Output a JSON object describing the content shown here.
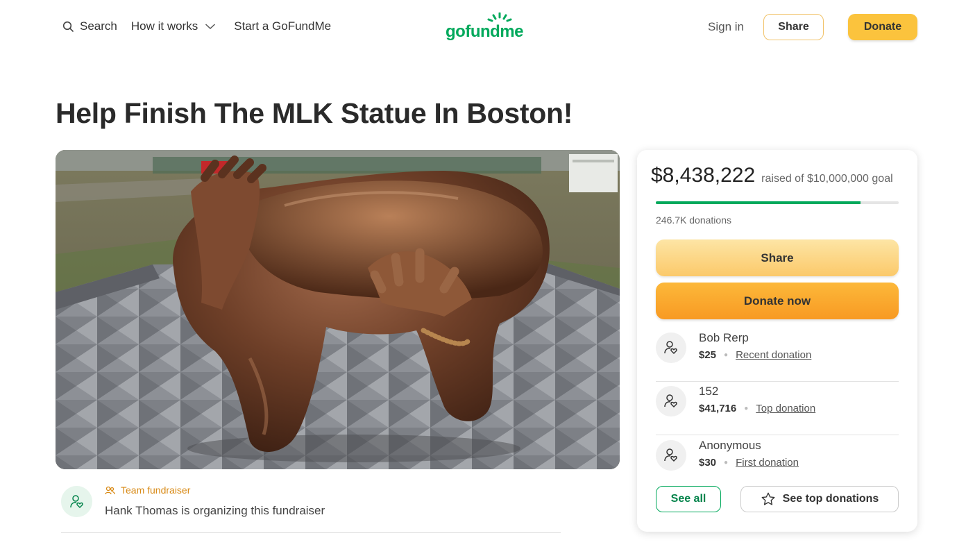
{
  "header": {
    "search_label": "Search",
    "how_it_works_label": "How it works",
    "start_label": "Start a GoFundMe",
    "logo_text": "gofundme",
    "signin_label": "Sign in",
    "share_label": "Share",
    "donate_label": "Donate"
  },
  "campaign": {
    "title": "Help Finish The MLK Statue In Boston!",
    "hero_image": "bronze embrace sculpture on patterned stone plaza"
  },
  "organizer": {
    "tag": "Team fundraiser",
    "text": "Hank Thomas is organizing this fundraiser"
  },
  "card": {
    "raised_amount": "$8,438,222",
    "goal_text": "raised of $10,000,000 goal",
    "progress_fraction": 0.8438,
    "donation_count": "246.7K donations",
    "share_label": "Share",
    "donate_label": "Donate now",
    "donors": [
      {
        "name": "Bob Rerp",
        "amount": "$25",
        "label": "Recent donation"
      },
      {
        "name": "152",
        "amount": "$41,716",
        "label": "Top donation"
      },
      {
        "name": "Anonymous",
        "amount": "$30",
        "label": "First donation"
      }
    ],
    "see_all_label": "See all",
    "see_top_label": "See top donations"
  },
  "colors": {
    "brand_green": "#02a95c",
    "donate_orange": "#f89a23",
    "share_yellow": "#fbc96a"
  }
}
